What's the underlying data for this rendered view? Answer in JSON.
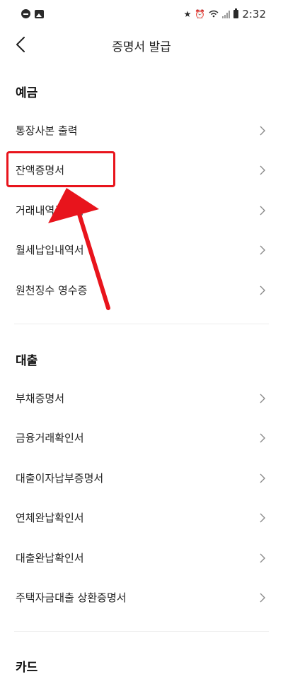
{
  "status_bar": {
    "time": "2:32"
  },
  "header": {
    "title": "증명서 발급"
  },
  "sections": [
    {
      "title": "예금",
      "items": [
        {
          "label": "통장사본 출력"
        },
        {
          "label": "잔액증명서"
        },
        {
          "label": "거래내역증명서"
        },
        {
          "label": "월세납입내역서"
        },
        {
          "label": "원천징수 영수증"
        }
      ]
    },
    {
      "title": "대출",
      "items": [
        {
          "label": "부채증명서"
        },
        {
          "label": "금융거래확인서"
        },
        {
          "label": "대출이자납부증명서"
        },
        {
          "label": "연체완납확인서"
        },
        {
          "label": "대출완납확인서"
        },
        {
          "label": "주택자금대출 상환증명서"
        }
      ]
    },
    {
      "title": "카드"
    }
  ],
  "annotation": {
    "highlight_color": "#e8141c"
  },
  "colors": {
    "background": "#ffffff",
    "text": "#222222",
    "chevron": "#8a8a8a",
    "divider": "#ececec"
  }
}
